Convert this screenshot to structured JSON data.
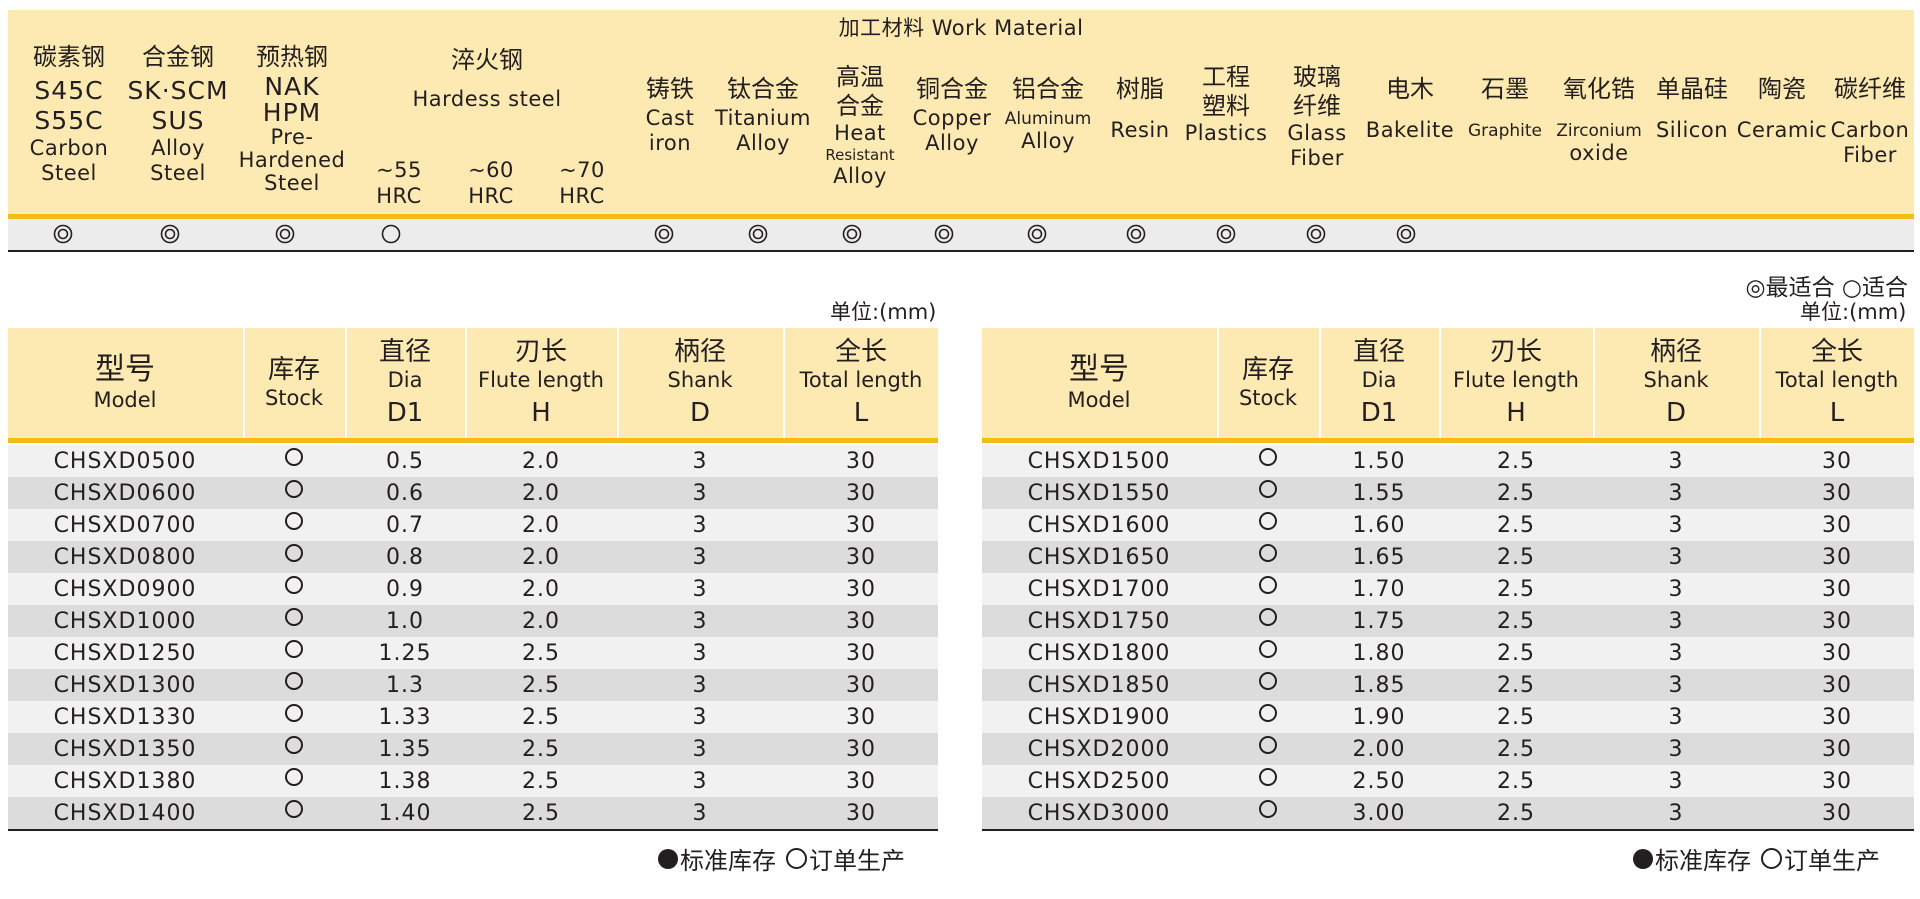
{
  "work_material": {
    "title": "加工材料 Work Material",
    "materials": [
      {
        "zh": "碳素钢",
        "code1": "S45C",
        "code2": "S55C",
        "en1": "Carbon",
        "en2": "Steel",
        "rating": "best"
      },
      {
        "zh": "合金钢",
        "code1": "SK·SCM",
        "code2": "SUS",
        "en1": "Alloy",
        "en2": "Steel",
        "rating": "best"
      },
      {
        "zh": "预热钢",
        "code1": "NAK",
        "code2": "HPM",
        "en1": "Pre-",
        "en2": "Hardened",
        "en3": "Steel",
        "rating": "best"
      },
      {
        "zh": "铸铁",
        "en1": "Cast",
        "en2": "iron",
        "rating": "best"
      },
      {
        "zh": "钛合金",
        "en1": "Titanium",
        "en2": "Alloy",
        "rating": "best"
      },
      {
        "zh": "高温",
        "zh2": "合金",
        "en1": "Heat",
        "en2": "Resistant",
        "en3": "Alloy",
        "rating": "best"
      },
      {
        "zh": "铜合金",
        "en1": "Copper",
        "en2": "Alloy",
        "rating": "best"
      },
      {
        "zh": "铝合金",
        "en1": "Aluminum",
        "en2": "Alloy",
        "rating": "best"
      },
      {
        "zh": "树脂",
        "en1": "Resin",
        "rating": "best"
      },
      {
        "zh": "工程",
        "zh2": "塑料",
        "en1": "Plastics",
        "rating": "best"
      },
      {
        "zh": "玻璃",
        "zh2": "纤维",
        "en1": "Glass",
        "en2": "Fiber",
        "rating": "best"
      },
      {
        "zh": "电木",
        "en1": "Bakelite",
        "rating": "best"
      },
      {
        "zh": "石墨",
        "en1": "Graphite",
        "rating": ""
      },
      {
        "zh": "氧化锆",
        "en1": "Zirconium",
        "en2": "oxide",
        "rating": ""
      },
      {
        "zh": "单晶硅",
        "en1": "Silicon",
        "rating": ""
      },
      {
        "zh": "陶瓷",
        "en1": "Ceramic",
        "rating": ""
      },
      {
        "zh": "碳纤维",
        "en1": "Carbon",
        "en2": "Fiber",
        "rating": ""
      }
    ],
    "hardened": {
      "zh": "淬火钢",
      "en": "Hardess steel",
      "grades": [
        {
          "lbl1": "~55",
          "lbl2": "HRC",
          "rating": "suitable"
        },
        {
          "lbl1": "~60",
          "lbl2": "HRC",
          "rating": ""
        },
        {
          "lbl1": "~70",
          "lbl2": "HRC",
          "rating": ""
        }
      ]
    }
  },
  "legend_top": "◎最适合 ○适合",
  "unit_label": "单位:(mm)",
  "headers": {
    "model_zh": "型号",
    "model_en": "Model",
    "stock_zh": "库存",
    "stock_en": "Stock",
    "dia_zh": "直径",
    "dia_en": "Dia",
    "dia_sym": "D1",
    "flute_zh": "刃长",
    "flute_en": "Flute length",
    "flute_sym": "H",
    "shank_zh": "柄径",
    "shank_en": "Shank",
    "shank_sym": "D",
    "total_zh": "全长",
    "total_en": "Total length",
    "total_sym": "L"
  },
  "left_table": [
    {
      "model": "CHSXD0500",
      "stock": "order",
      "dia": "0.5",
      "flute": "2.0",
      "shank": "3",
      "total": "30"
    },
    {
      "model": "CHSXD0600",
      "stock": "order",
      "dia": "0.6",
      "flute": "2.0",
      "shank": "3",
      "total": "30"
    },
    {
      "model": "CHSXD0700",
      "stock": "order",
      "dia": "0.7",
      "flute": "2.0",
      "shank": "3",
      "total": "30"
    },
    {
      "model": "CHSXD0800",
      "stock": "order",
      "dia": "0.8",
      "flute": "2.0",
      "shank": "3",
      "total": "30"
    },
    {
      "model": "CHSXD0900",
      "stock": "order",
      "dia": "0.9",
      "flute": "2.0",
      "shank": "3",
      "total": "30"
    },
    {
      "model": "CHSXD1000",
      "stock": "order",
      "dia": "1.0",
      "flute": "2.0",
      "shank": "3",
      "total": "30"
    },
    {
      "model": "CHSXD1250",
      "stock": "order",
      "dia": "1.25",
      "flute": "2.5",
      "shank": "3",
      "total": "30"
    },
    {
      "model": "CHSXD1300",
      "stock": "order",
      "dia": "1.3",
      "flute": "2.5",
      "shank": "3",
      "total": "30"
    },
    {
      "model": "CHSXD1330",
      "stock": "order",
      "dia": "1.33",
      "flute": "2.5",
      "shank": "3",
      "total": "30"
    },
    {
      "model": "CHSXD1350",
      "stock": "order",
      "dia": "1.35",
      "flute": "2.5",
      "shank": "3",
      "total": "30"
    },
    {
      "model": "CHSXD1380",
      "stock": "order",
      "dia": "1.38",
      "flute": "2.5",
      "shank": "3",
      "total": "30"
    },
    {
      "model": "CHSXD1400",
      "stock": "order",
      "dia": "1.40",
      "flute": "2.5",
      "shank": "3",
      "total": "30"
    }
  ],
  "right_table": [
    {
      "model": "CHSXD1500",
      "stock": "order",
      "dia": "1.50",
      "flute": "2.5",
      "shank": "3",
      "total": "30"
    },
    {
      "model": "CHSXD1550",
      "stock": "order",
      "dia": "1.55",
      "flute": "2.5",
      "shank": "3",
      "total": "30"
    },
    {
      "model": "CHSXD1600",
      "stock": "order",
      "dia": "1.60",
      "flute": "2.5",
      "shank": "3",
      "total": "30"
    },
    {
      "model": "CHSXD1650",
      "stock": "order",
      "dia": "1.65",
      "flute": "2.5",
      "shank": "3",
      "total": "30"
    },
    {
      "model": "CHSXD1700",
      "stock": "order",
      "dia": "1.70",
      "flute": "2.5",
      "shank": "3",
      "total": "30"
    },
    {
      "model": "CHSXD1750",
      "stock": "order",
      "dia": "1.75",
      "flute": "2.5",
      "shank": "3",
      "total": "30"
    },
    {
      "model": "CHSXD1800",
      "stock": "order",
      "dia": "1.80",
      "flute": "2.5",
      "shank": "3",
      "total": "30"
    },
    {
      "model": "CHSXD1850",
      "stock": "order",
      "dia": "1.85",
      "flute": "2.5",
      "shank": "3",
      "total": "30"
    },
    {
      "model": "CHSXD1900",
      "stock": "order",
      "dia": "1.90",
      "flute": "2.5",
      "shank": "3",
      "total": "30"
    },
    {
      "model": "CHSXD2000",
      "stock": "order",
      "dia": "2.00",
      "flute": "2.5",
      "shank": "3",
      "total": "30"
    },
    {
      "model": "CHSXD2500",
      "stock": "order",
      "dia": "2.50",
      "flute": "2.5",
      "shank": "3",
      "total": "30"
    },
    {
      "model": "CHSXD3000",
      "stock": "order",
      "dia": "3.00",
      "flute": "2.5",
      "shank": "3",
      "total": "30"
    }
  ],
  "legend_bottom": {
    "standard": "标准库存",
    "order": "订单生产"
  },
  "colors": {
    "header_bg": "#fde9b2",
    "accent_line": "#f5bb16",
    "row_light": "#f1f1f1",
    "row_dark": "#dcdcdc",
    "text": "#231f20"
  }
}
